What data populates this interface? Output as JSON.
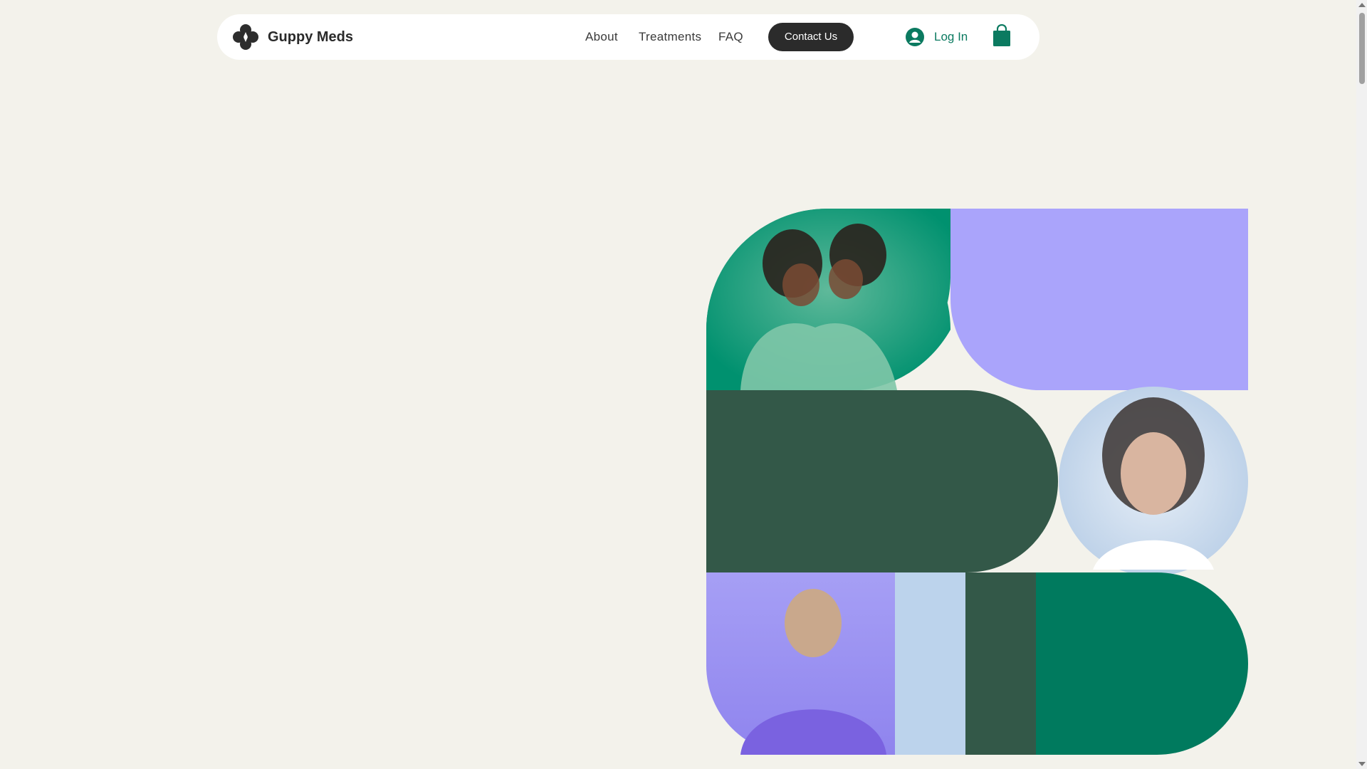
{
  "header": {
    "brand": "Guppy Meds",
    "logo_icon": "guppy-logo-icon",
    "nav": [
      {
        "label": "About"
      },
      {
        "label": "Treatments"
      },
      {
        "label": "FAQ"
      }
    ],
    "contact_label": "Contact Us",
    "login_label": "Log In",
    "login_icon": "user-avatar-icon",
    "cart_icon": "shopping-bag-icon"
  },
  "hero": {
    "photos": [
      {
        "name": "mother-child-photo"
      },
      {
        "name": "woman-portrait-photo"
      },
      {
        "name": "man-smiling-photo"
      }
    ]
  },
  "colors": {
    "background": "#f3f2eb",
    "teal": "#00916f",
    "lavender": "#aaa4fb",
    "dark_green": "#335848",
    "light_blue": "#bcd3ec",
    "deep_teal": "#007a5e",
    "accent_text": "#0b7a60"
  }
}
